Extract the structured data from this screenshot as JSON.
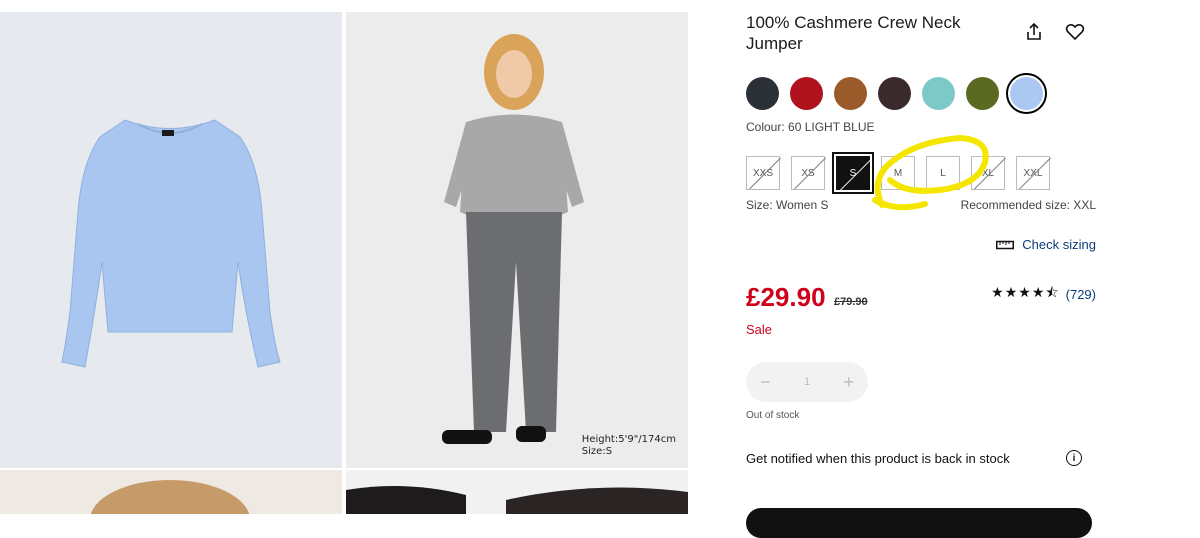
{
  "gallery": {
    "model_caption_height": "Height:5'9\"/174cm",
    "model_caption_size": "Size:S"
  },
  "product": {
    "title": "100% Cashmere Crew Neck Jumper",
    "share_icon": "share-icon",
    "wishlist_icon": "heart-icon"
  },
  "colours": {
    "swatches": [
      "#2b2f36",
      "#b0131d",
      "#9a5a2a",
      "#3a2a2c",
      "#7cc9c8",
      "#5b6a22",
      "#aac8f2"
    ],
    "selected_index": 6,
    "label": "Colour: 60 LIGHT BLUE"
  },
  "sizes": {
    "options": [
      "XXS",
      "XS",
      "S",
      "M",
      "L",
      "XL",
      "XXL"
    ],
    "selected": "S",
    "label": "Size: Women S",
    "recommended": "Recommended size: XXL",
    "check_sizing": "Check sizing"
  },
  "pricing": {
    "price": "£29.90",
    "original_price": "£79.90",
    "sale_label": "Sale",
    "accent": "#d0021b"
  },
  "rating": {
    "stars": "★★★★⯪",
    "value": 4.5,
    "reviews": "(729)"
  },
  "quantity": {
    "minus": "−",
    "value": "1",
    "plus": "+",
    "stock_status": "Out of stock"
  },
  "notify": {
    "text": "Get notified when this product is back in stock"
  }
}
